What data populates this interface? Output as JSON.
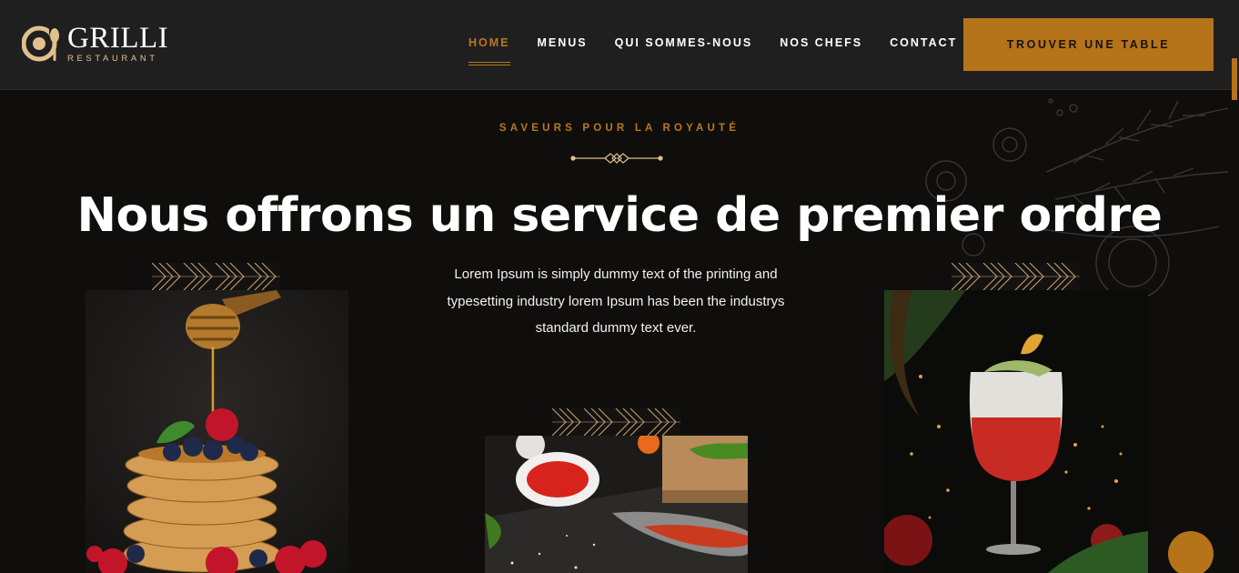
{
  "brand": {
    "name": "GRILLI",
    "tagline": "RESTAURANT"
  },
  "nav": {
    "items": [
      {
        "label": "HOME"
      },
      {
        "label": "MENUS"
      },
      {
        "label": "QUI SOMMES-NOUS"
      },
      {
        "label": "NOS CHEFS"
      },
      {
        "label": "CONTACT"
      }
    ],
    "cta": "TROUVER UNE TABLE"
  },
  "hero": {
    "kicker": "SAVEURS POUR LA ROYAUTÉ",
    "headline": "Nous offrons un service de premier ordre",
    "lead": "Lorem Ipsum is simply dummy text of the printing and typesetting industry lorem Ipsum has been the industrys standard dummy text ever."
  },
  "colors": {
    "accent": "#b5731a",
    "header_bg": "#1f1f1f",
    "page_bg": "#0f0e0d",
    "gold_light": "#e0c08c"
  },
  "icons": [
    "logo-icon",
    "divider-ornament",
    "pattern-ornament",
    "back-to-top-icon"
  ]
}
